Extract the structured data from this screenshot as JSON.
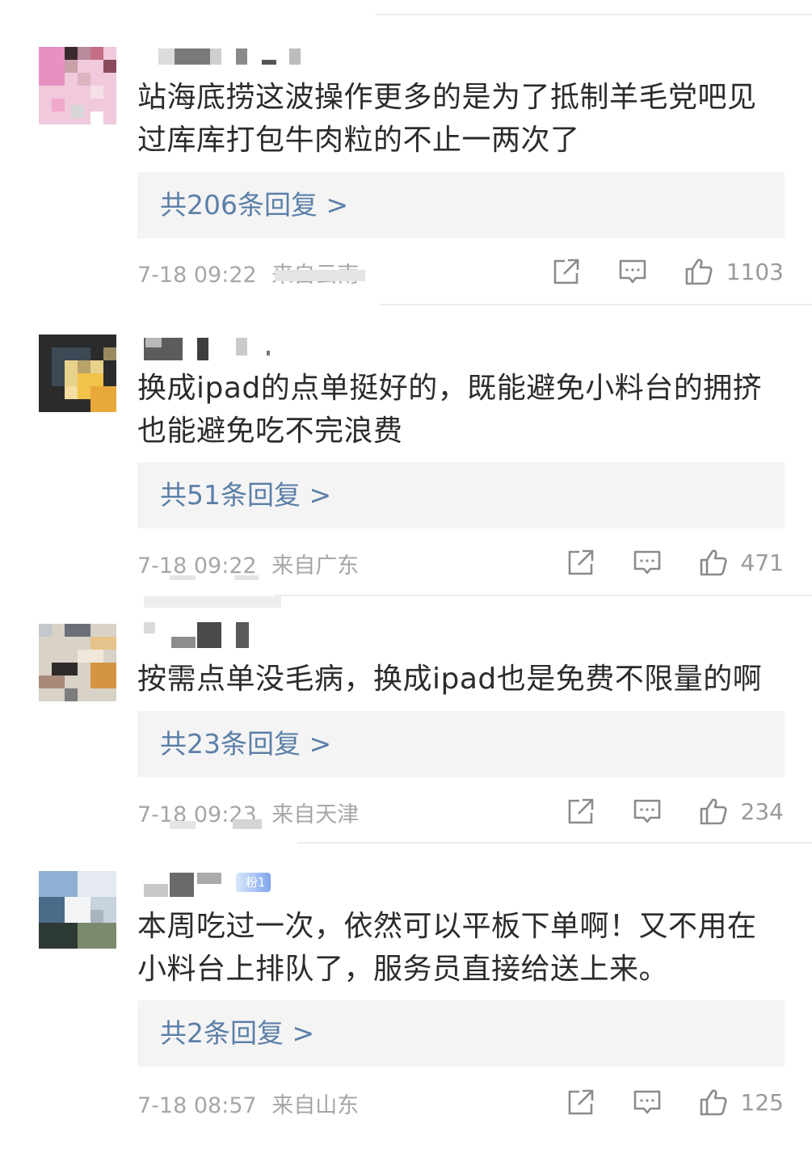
{
  "comments": [
    {
      "text": "站海底捞这波操作更多的是为了抵制羊毛党吧见过库库打包牛肉粒的不止一两次了",
      "replies_label": "共206条回复 >",
      "time": "7-18 09:22",
      "source": "来自云南",
      "likes": "1103"
    },
    {
      "text": "换成ipad的点单挺好的，既能避免小料台的拥挤也能避免吃不完浪费",
      "replies_label": "共51条回复 >",
      "time": "7-18 09:22",
      "source": "来自广东",
      "likes": "471"
    },
    {
      "text": "按需点单没毛病，换成ipad也是免费不限量的啊",
      "replies_label": "共23条回复 >",
      "time": "7-18 09:23",
      "source": "来自天津",
      "likes": "234"
    },
    {
      "text": "本周吃过一次，依然可以平板下单啊！又不用在小料台上排队了，服务员直接给送上来。",
      "replies_label": "共2条回复 >",
      "time": "7-18 08:57",
      "source": "来自山东",
      "likes": "125",
      "badge": "粉1"
    }
  ],
  "icons": {
    "share": "share-icon",
    "comment": "comment-icon",
    "like": "like-icon"
  },
  "colors": {
    "reply_link": "#5b7fa8",
    "meta": "#a6a6a6",
    "reply_bg": "#f4f4f4"
  }
}
